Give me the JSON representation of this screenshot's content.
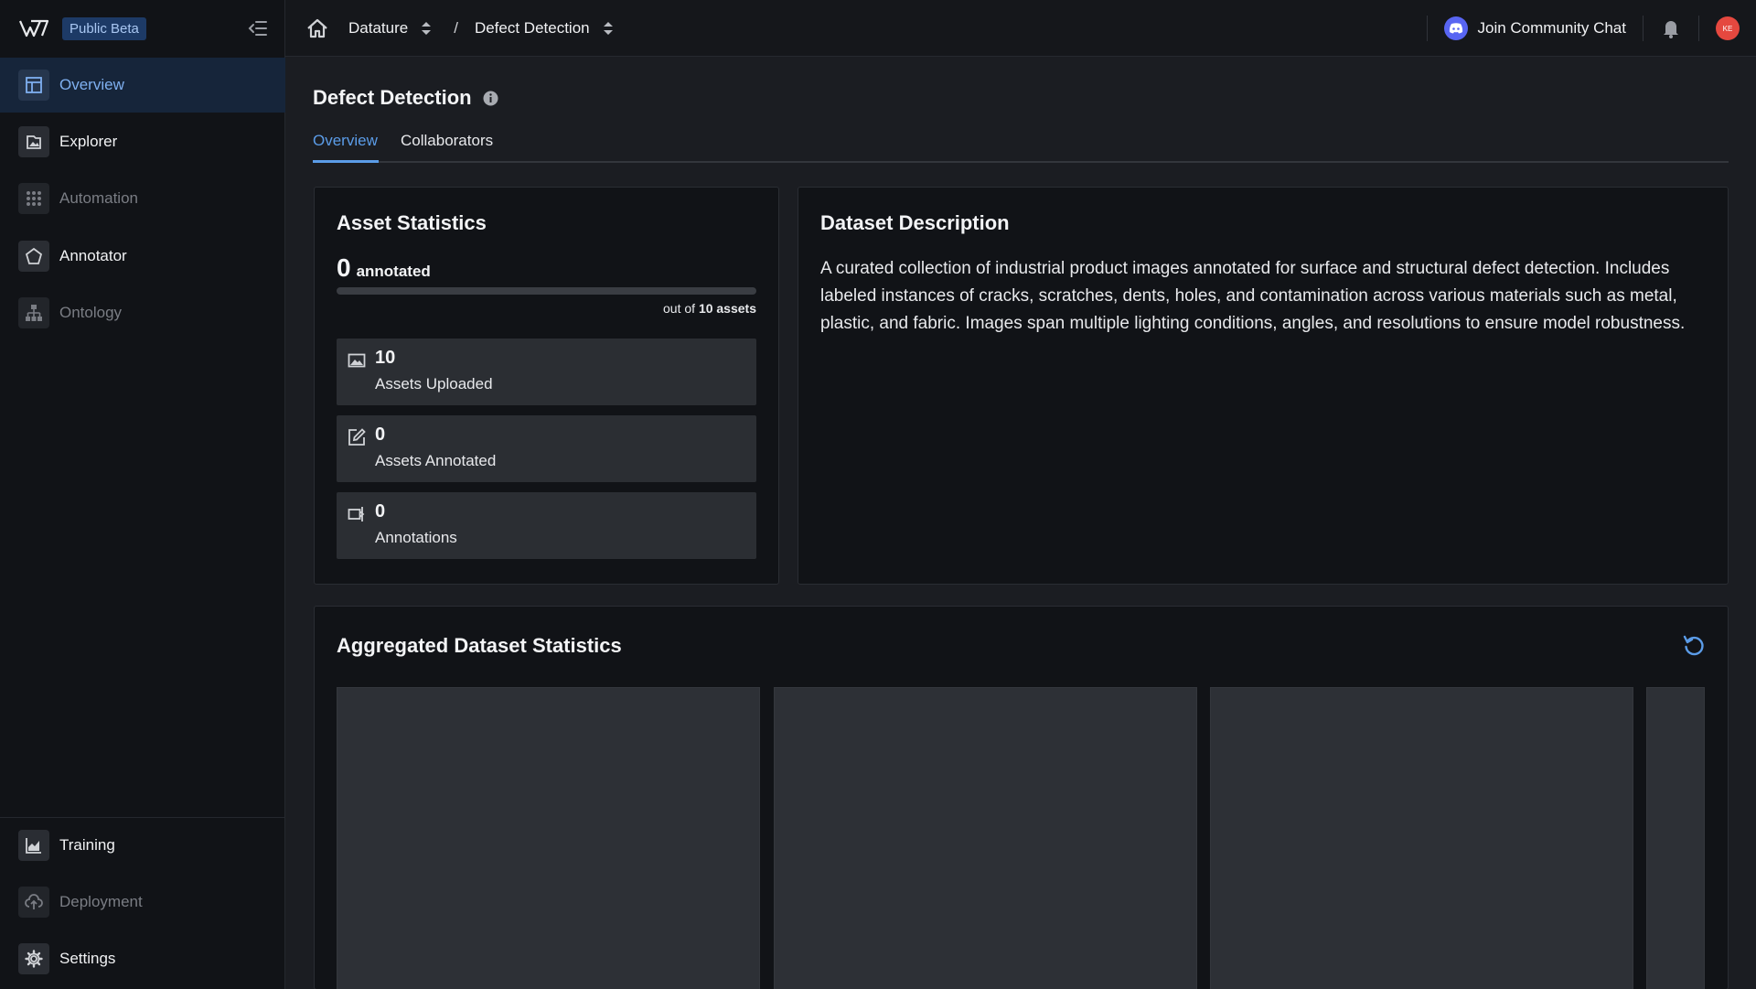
{
  "sidebar": {
    "badge": "Public Beta",
    "items": [
      {
        "label": "Overview"
      },
      {
        "label": "Explorer"
      },
      {
        "label": "Automation"
      },
      {
        "label": "Annotator"
      },
      {
        "label": "Ontology"
      }
    ],
    "bottom_items": [
      {
        "label": "Training"
      },
      {
        "label": "Deployment"
      },
      {
        "label": "Settings"
      }
    ]
  },
  "topbar": {
    "org": "Datature",
    "separator": "/",
    "project": "Defect Detection",
    "community": "Join Community Chat",
    "avatar_initials": "KE"
  },
  "main": {
    "title": "Defect Detection",
    "tabs": [
      {
        "label": "Overview"
      },
      {
        "label": "Collaborators"
      }
    ]
  },
  "asset_statistics": {
    "title": "Asset Statistics",
    "annotated_count": "0",
    "annotated_label": "annotated",
    "progress_fraction": 0,
    "out_of_prefix": "out of",
    "out_of_value": "10 assets",
    "stats": [
      {
        "value": "10",
        "label": "Assets Uploaded",
        "icon": "image-icon"
      },
      {
        "value": "0",
        "label": "Assets Annotated",
        "icon": "edit-icon"
      },
      {
        "value": "0",
        "label": "Annotations",
        "icon": "label-icon"
      }
    ]
  },
  "dataset_description": {
    "title": "Dataset Description",
    "text": "A curated collection of industrial product images annotated for surface and structural defect detection. Includes labeled instances of cracks, scratches, dents, holes, and contamination across various materials such as metal, plastic, and fabric. Images span multiple lighting conditions, angles, and resolutions to ensure model robustness."
  },
  "aggregated": {
    "title": "Aggregated Dataset Statistics"
  },
  "colors": {
    "accent": "#5b9ce8",
    "avatar": "#e5483f",
    "discord": "#5865f2"
  }
}
